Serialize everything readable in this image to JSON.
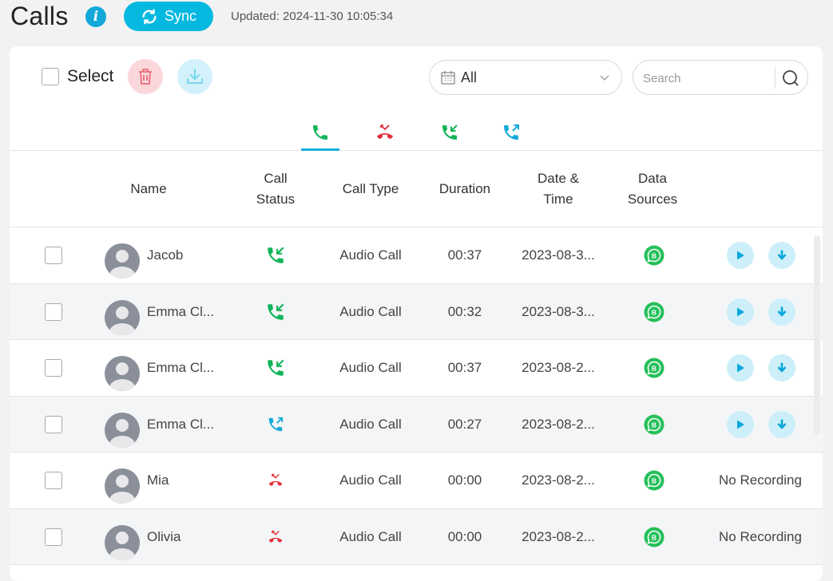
{
  "header": {
    "title": "Calls",
    "info_icon": "info-icon",
    "sync_label": "Sync",
    "updated": "Updated: 2024-11-30 10:05:34"
  },
  "toolbar": {
    "select_label": "Select",
    "delete_icon": "trash-icon",
    "download_icon": "download-icon",
    "date_filter": {
      "value": "All",
      "icon": "calendar-icon"
    },
    "search": {
      "placeholder": "Search",
      "value": ""
    }
  },
  "tabs": [
    {
      "name": "all-calls",
      "icon": "phone-icon",
      "active": true
    },
    {
      "name": "missed",
      "icon": "missed-call-icon",
      "active": false
    },
    {
      "name": "incoming",
      "icon": "incoming-call-icon",
      "active": false
    },
    {
      "name": "outgoing",
      "icon": "outgoing-call-icon",
      "active": false
    }
  ],
  "columns": {
    "name": "Name",
    "status": "Call\nStatus",
    "type": "Call Type",
    "duration": "Duration",
    "datetime": "Date &\nTime",
    "source": "Data\nSources"
  },
  "colors": {
    "accent": "#05b8e0",
    "incoming": "#12b45a",
    "outgoing": "#12a9d8",
    "missed": "#e0303a",
    "delete_bg": "#fbd7dc",
    "action_bg": "#cdeff9"
  },
  "rows": [
    {
      "name": "Jacob",
      "status": "incoming",
      "type": "Audio Call",
      "duration": "00:37",
      "datetime": "2023-08-3...",
      "source": "whatsapp-business",
      "recording": true
    },
    {
      "name": "Emma Cl...",
      "status": "incoming",
      "type": "Audio Call",
      "duration": "00:32",
      "datetime": "2023-08-3...",
      "source": "whatsapp-business",
      "recording": true
    },
    {
      "name": "Emma Cl...",
      "status": "incoming",
      "type": "Audio Call",
      "duration": "00:37",
      "datetime": "2023-08-2...",
      "source": "whatsapp-business",
      "recording": true
    },
    {
      "name": "Emma Cl...",
      "status": "outgoing",
      "type": "Audio Call",
      "duration": "00:27",
      "datetime": "2023-08-2...",
      "source": "whatsapp-business",
      "recording": true
    },
    {
      "name": "Mia",
      "status": "missed",
      "type": "Audio Call",
      "duration": "00:00",
      "datetime": "2023-08-2...",
      "source": "whatsapp-business",
      "recording": false,
      "recording_text": "No Recording"
    },
    {
      "name": "Olivia",
      "status": "missed",
      "type": "Audio Call",
      "duration": "00:00",
      "datetime": "2023-08-2...",
      "source": "whatsapp-business",
      "recording": false,
      "recording_text": "No Recording"
    }
  ]
}
